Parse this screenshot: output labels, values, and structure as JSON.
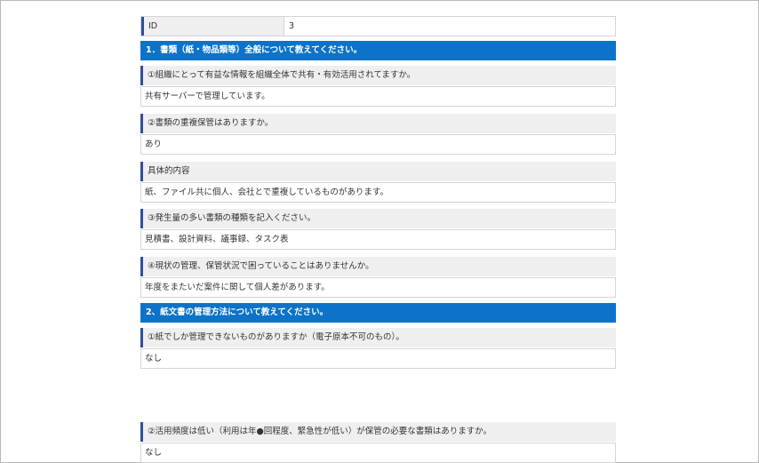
{
  "id_row": {
    "label": "ID",
    "value": "3"
  },
  "sections": [
    {
      "title": "1．書類（紙・物品類等）全般について教えてください。"
    },
    {
      "title": "2、紙文書の管理方法について教えてください。"
    }
  ],
  "items": [
    {
      "question": "①組織にとって有益な情報を組織全体で共有・有効活用されてますか。",
      "answer": "共有サーバーで管理しています。"
    },
    {
      "question": "②書類の重複保管はありますか。",
      "answer": "あり"
    },
    {
      "question": "具体的内容",
      "answer": "紙、ファイル共に個人、会社とで重複しているものがあります。"
    },
    {
      "question": "③発生量の多い書類の種類を記入ください。",
      "answer": "見積書、設計資料、議事録、タスク表"
    },
    {
      "question": "④現状の管理、保管状況で困っていることはありませんか。",
      "answer": "年度をまたいだ案件に関して個人差があります。"
    },
    {
      "question": "①紙でしか管理できないものがありますか（電子原本不可のもの）。",
      "answer": "なし"
    },
    {
      "question": "②活用頻度は低い（利用は年●回程度、緊急性が低い）が保管の必要な書類はありますか。",
      "answer": "なし"
    }
  ]
}
